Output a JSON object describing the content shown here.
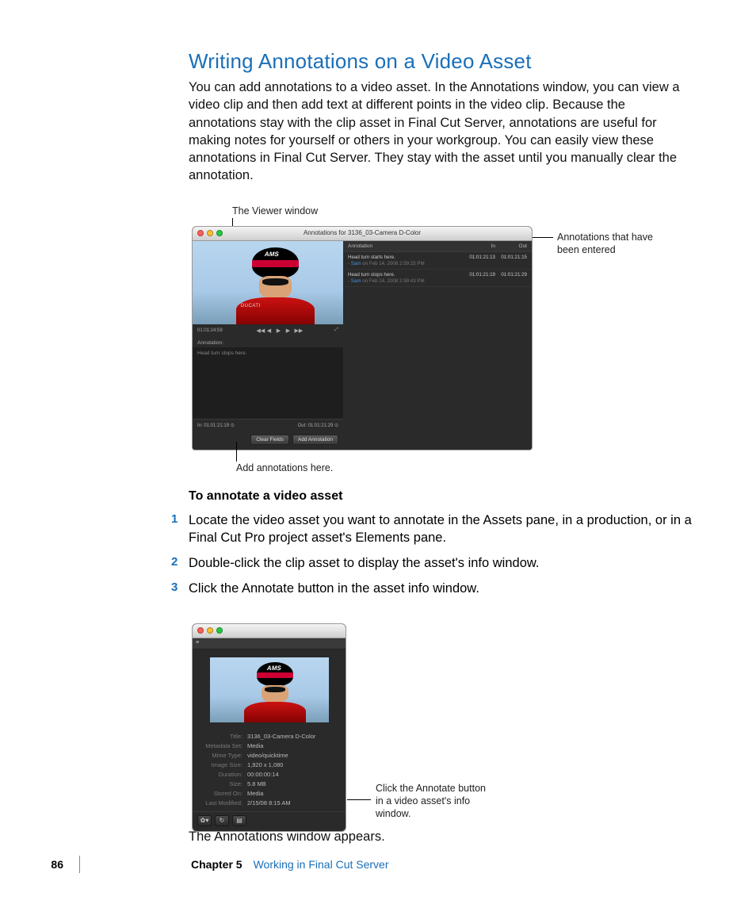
{
  "heading": "Writing Annotations on a Video Asset",
  "intro": "You can add annotations to a video asset. In the Annotations window, you can view a video clip and then add text at different points in the video clip. Because the annotations stay with the clip asset in Final Cut Server, annotations are useful for making notes for yourself or others in your workgroup. You can easily view these annotations in Final Cut Server. They stay with the asset until you manually clear the annotation.",
  "callouts": {
    "viewer": "The Viewer window",
    "entered": "Annotations that have been entered",
    "add_here": "Add annotations here.",
    "click_annotate": "Click the Annotate button in a video asset's info window."
  },
  "ann_window": {
    "title": "Annotations for 3136_03-Camera D-Color",
    "timecode_current": "01:01:24:59",
    "controls": {
      "rew": "◀◀",
      "back": "◀",
      "play": "▶",
      "fwd": "▶",
      "ffwd": "▶▶"
    },
    "input_label": "Annotation:",
    "placeholder": "Head turn stops here.",
    "in_label": "In:",
    "in_tc": "01:01:21:19",
    "out_label": "Out:",
    "out_tc": "01:01:21:29",
    "clear_btn": "Clear Fields",
    "add_btn": "Add Annotation",
    "list_header": {
      "ann": "Annotation",
      "in": "In",
      "out": "Out"
    },
    "rows": [
      {
        "text": "Head turn starts here.",
        "in": "01:01:21:13",
        "out": "01:01:21:15",
        "by": "Sam",
        "date": "on Feb 14, 2008 2:59:25 PM"
      },
      {
        "text": "Head turn stops here.",
        "in": "01:01:21:19",
        "out": "01:01:21:29",
        "by": "Sam",
        "date": "on Feb 14, 2008 2:59:43 PM"
      }
    ],
    "helmet_logo": "AMS",
    "body_logo": "DUCATI"
  },
  "info_window": {
    "meta": [
      {
        "label": "Title:",
        "value": "3136_03-Camera D-Color"
      },
      {
        "label": "Metadata Set:",
        "value": "Media"
      },
      {
        "label": "Mime Type:",
        "value": "video/quicktime"
      },
      {
        "label": "Image Size:",
        "value": "1,920 x 1,080"
      },
      {
        "label": "Duration:",
        "value": "00:00:00:14"
      },
      {
        "label": "Size:",
        "value": "5.8 MB"
      },
      {
        "label": "Stored On:",
        "value": "Media"
      },
      {
        "label": "Last Modified:",
        "value": "2/15/08 8:15 AM"
      }
    ]
  },
  "subheading": "To annotate a video asset",
  "steps": [
    "Locate the video asset you want to annotate in the Assets pane, in a production, or in a Final Cut Pro project asset's Elements pane.",
    "Double-click the clip asset to display the asset's info window.",
    "Click the Annotate button in the asset info window."
  ],
  "follow": "The Annotations window appears.",
  "footer": {
    "page": "86",
    "chapter": "Chapter 5",
    "title": "Working in Final Cut Server"
  }
}
